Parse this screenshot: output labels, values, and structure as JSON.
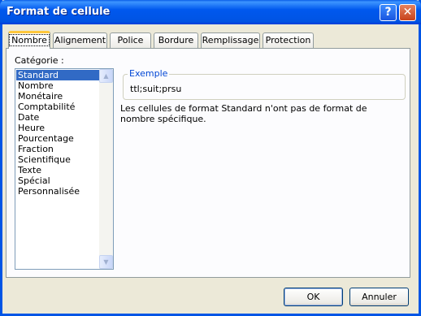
{
  "window": {
    "title": "Format de cellule",
    "help_symbol": "?",
    "close_symbol": "✕"
  },
  "tabs": [
    {
      "label": "Nombre",
      "active": true
    },
    {
      "label": "Alignement"
    },
    {
      "label": "Police"
    },
    {
      "label": "Bordure"
    },
    {
      "label": "Remplissage"
    },
    {
      "label": "Protection"
    }
  ],
  "category": {
    "label": "Catégorie :",
    "items": [
      "Standard",
      "Nombre",
      "Monétaire",
      "Comptabilité",
      "Date",
      "Heure",
      "Pourcentage",
      "Fraction",
      "Scientifique",
      "Texte",
      "Spécial",
      "Personnalisée"
    ],
    "selected": "Standard"
  },
  "sample": {
    "title": "Exemple",
    "value": "ttl;suit;prsu"
  },
  "description": "Les cellules de format Standard n'ont pas de format de nombre spécifique.",
  "buttons": {
    "ok": "OK",
    "cancel": "Annuler"
  },
  "colors": {
    "titlebar": "#0054e3",
    "selection": "#316ac5",
    "group_title": "#0046d5",
    "active_tab_accent": "#ffc83c"
  }
}
